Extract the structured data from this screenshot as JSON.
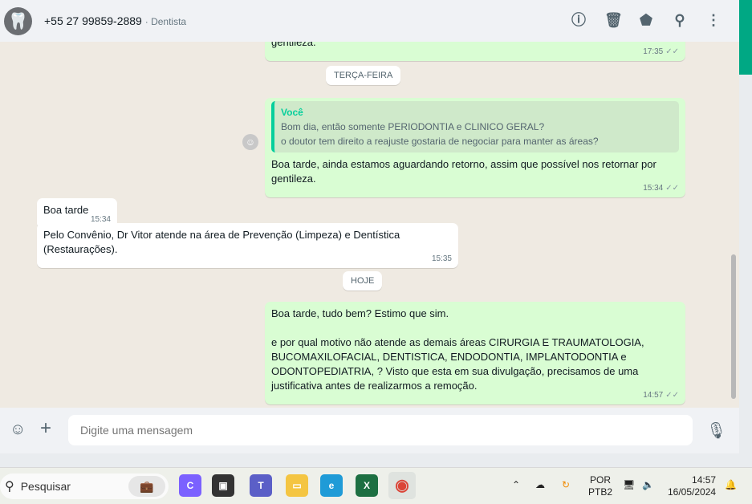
{
  "header": {
    "contact": "+55 27 99859-2889",
    "label": "· Dentista",
    "avatar_icon": "tooth-icon",
    "icons": [
      "info-icon",
      "trash-icon",
      "label-icon",
      "search-icon",
      "menu-icon"
    ]
  },
  "messages": [
    {
      "type": "out",
      "text": "gentileza.",
      "time": "17:35"
    },
    {
      "type": "date",
      "text": "TERÇA-FEIRA"
    },
    {
      "type": "out",
      "quote_author": "Você",
      "quote_line1": "Bom dia, então somente PERIODONTIA e CLINICO GERAL?",
      "quote_line2": "o doutor tem direito a reajuste gostaria de negociar para manter as áreas?",
      "text": "Boa tarde, ainda estamos aguardando retorno, assim que possível nos retornar por gentileza.",
      "time": "15:34"
    },
    {
      "type": "in",
      "text": "Boa tarde",
      "time": "15:34"
    },
    {
      "type": "in",
      "text": "Pelo Convênio, Dr Vitor atende na área de Prevenção (Limpeza) e Dentística (Restaurações).",
      "time": "15:35"
    },
    {
      "type": "date",
      "text": "HOJE"
    },
    {
      "type": "out",
      "line1": "Boa tarde, tudo bem? Estimo que sim.",
      "line2": "e por qual motivo não atende as demais áreas  CIRURGIA E TRAUMATOLOGIA, BUCOMAXILOFACIAL, DENTISTICA, ENDODONTIA, IMPLANTODONTIA e ODONTOPEDIATRIA,  ? Visto que esta em sua divulgação, precisamos de uma justificativa antes de realizarmos a remoção.",
      "time": "14:57"
    }
  ],
  "composer": {
    "placeholder": "Digite uma mensagem"
  },
  "taskbar": {
    "search": "Pesquisar",
    "lang1": "POR",
    "lang2": "PTB2",
    "time": "14:57",
    "date": "16/05/2024"
  }
}
